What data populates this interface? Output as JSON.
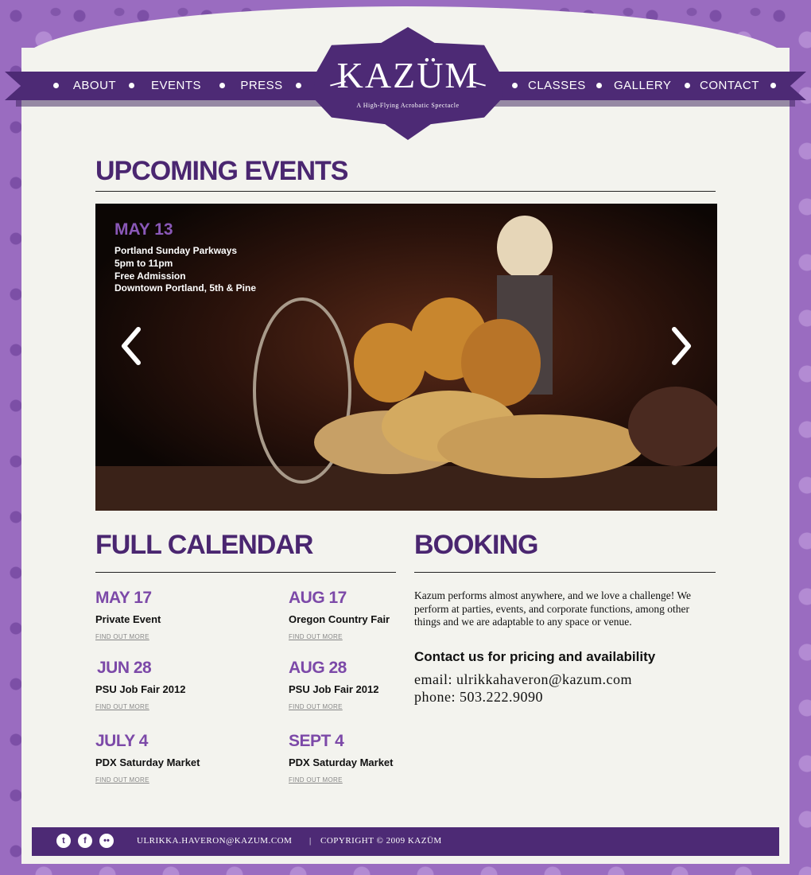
{
  "brand": {
    "name": "KAZÜM",
    "tagline": "A High-Flying Acrobatic Spectacle",
    "accent": "#4d2a75",
    "purple_text": "#7c49a8"
  },
  "nav": {
    "about": "ABOUT",
    "events": "EVENTS",
    "press": "PRESS",
    "classes": "CLASSES",
    "gallery": "GALLERY",
    "contact": "CONTACT"
  },
  "upcoming": {
    "heading": "UPCOMING EVENTS",
    "slide": {
      "date": "MAY 13",
      "line1": "Portland Sunday Parkways",
      "line2": "5pm to 11pm",
      "line3": "Free Admission",
      "line4": "Downtown Portland, 5th & Pine"
    },
    "prev_icon": "chevron-left",
    "next_icon": "chevron-right"
  },
  "calendar": {
    "heading": "FULL CALENDAR",
    "link_label": "FIND OUT MORE",
    "events": [
      {
        "date": "MAY 17",
        "name": "Private Event"
      },
      {
        "date": "AUG 17",
        "name": "Oregon Country Fair"
      },
      {
        "date": "JUN 28",
        "name": "PSU Job Fair 2012"
      },
      {
        "date": "AUG 28",
        "name": "PSU Job Fair 2012"
      },
      {
        "date": "JULY 4",
        "name": "PDX Saturday Market"
      },
      {
        "date": "SEPT 4",
        "name": "PDX Saturday Market"
      }
    ]
  },
  "booking": {
    "heading": "BOOKING",
    "body": "Kazum performs almost anywhere, and we love a challenge! We perform at parties, events, and corporate functions, among other things and we are adaptable to any space or venue.",
    "contact_heading": "Contact us for pricing and availability",
    "email_line": "email: ulrikkahaveron@kazum.com",
    "phone_line": "phone: 503.222.9090"
  },
  "footer": {
    "social": [
      "tumblr-icon",
      "facebook-icon",
      "flickr-icon"
    ],
    "email": "ULRIKKA.HAVERON@KAZUM.COM",
    "separator": "|",
    "copyright": "COPYRIGHT © 2009 KAZÜM"
  }
}
